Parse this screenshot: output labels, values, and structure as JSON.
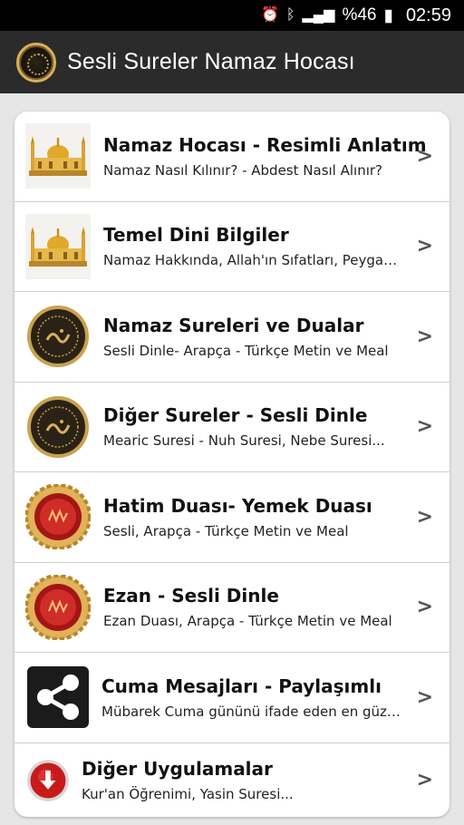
{
  "status_bar": {
    "battery": "%46",
    "time": "02:59",
    "icons": [
      "alarm-icon",
      "bluetooth-icon",
      "signal-icon",
      "battery-icon"
    ]
  },
  "app_bar": {
    "title": "Sesli Sureler Namaz Hocası",
    "logo": "calligraphy-medallion-icon"
  },
  "menu": {
    "items": [
      {
        "title": "Namaz Hocası - Resimli Anlatım",
        "subtitle": "Namaz Nasıl Kılınır? - Abdest Nasıl Alınır?",
        "icon": "mosque-icon"
      },
      {
        "title": "Temel Dini Bilgiler",
        "subtitle": "Namaz Hakkında, Allah'ın Sıfatları, Peygam...",
        "icon": "mosque-icon"
      },
      {
        "title": "Namaz Sureleri ve Dualar",
        "subtitle": "Sesli Dinle- Arapça - Türkçe Metin ve Meal",
        "icon": "calligraphy-medallion-icon"
      },
      {
        "title": "Diğer Sureler - Sesli Dinle",
        "subtitle": "Mearic Suresi - Nuh Suresi, Nebe Suresi...",
        "icon": "calligraphy-medallion-icon"
      },
      {
        "title": "Hatim Duası- Yemek Duası",
        "subtitle": "Sesli, Arapça - Türkçe Metin ve Meal",
        "icon": "red-medallion-icon"
      },
      {
        "title": "Ezan - Sesli Dinle",
        "subtitle": "Ezan Duası, Arapça - Türkçe Metin ve Meal",
        "icon": "red-medallion-icon"
      },
      {
        "title": "Cuma Mesajları - Paylaşımlı",
        "subtitle": "Mübarek Cuma gününü ifade eden en güzel...",
        "icon": "share-icon"
      },
      {
        "title": "Diğer Uygulamalar",
        "subtitle": "Kur'an Öğrenimi, Yasin Suresi...",
        "icon": "download-icon"
      }
    ],
    "chevron": ">"
  },
  "colors": {
    "status_bar_bg": "#000000",
    "app_bar_bg": "#2b2b2b",
    "page_bg": "#e6e6e6",
    "card_bg": "#ffffff"
  }
}
